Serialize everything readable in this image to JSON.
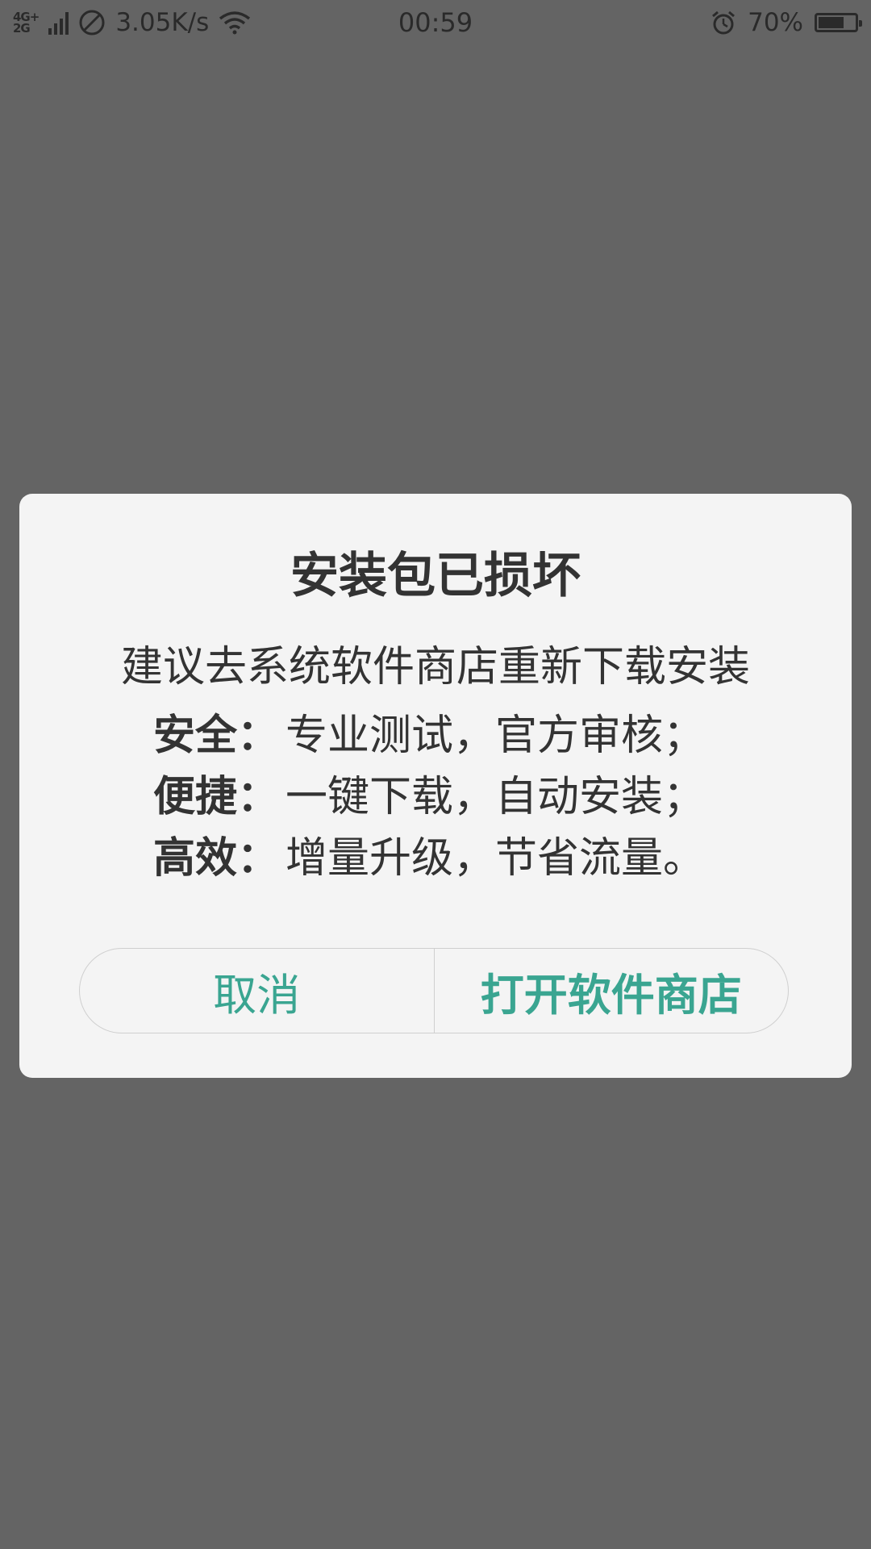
{
  "status_bar": {
    "network_type_top": "4G+",
    "network_type_bottom": "2G",
    "speed": "3.05K/s",
    "time": "00:59",
    "battery_percent_text": "70%",
    "battery_level": 0.7,
    "icons": [
      "signal-icon",
      "no-disturb-icon",
      "wifi-icon",
      "alarm-icon",
      "battery-icon"
    ]
  },
  "dialog": {
    "title": "安装包已损坏",
    "message": "建议去系统软件商店重新下载安装",
    "features": [
      {
        "key": "安全：",
        "value": "专业测试，官方审核；"
      },
      {
        "key": "便捷：",
        "value": "一键下载，自动安装；"
      },
      {
        "key": "高效：",
        "value": "增量升级，节省流量。"
      }
    ],
    "cancel_label": "取消",
    "confirm_label": "打开软件商店"
  },
  "colors": {
    "background_overlay": "#646464",
    "dialog_background": "#f4f4f4",
    "accent": "#3aa591",
    "text": "#333333"
  }
}
